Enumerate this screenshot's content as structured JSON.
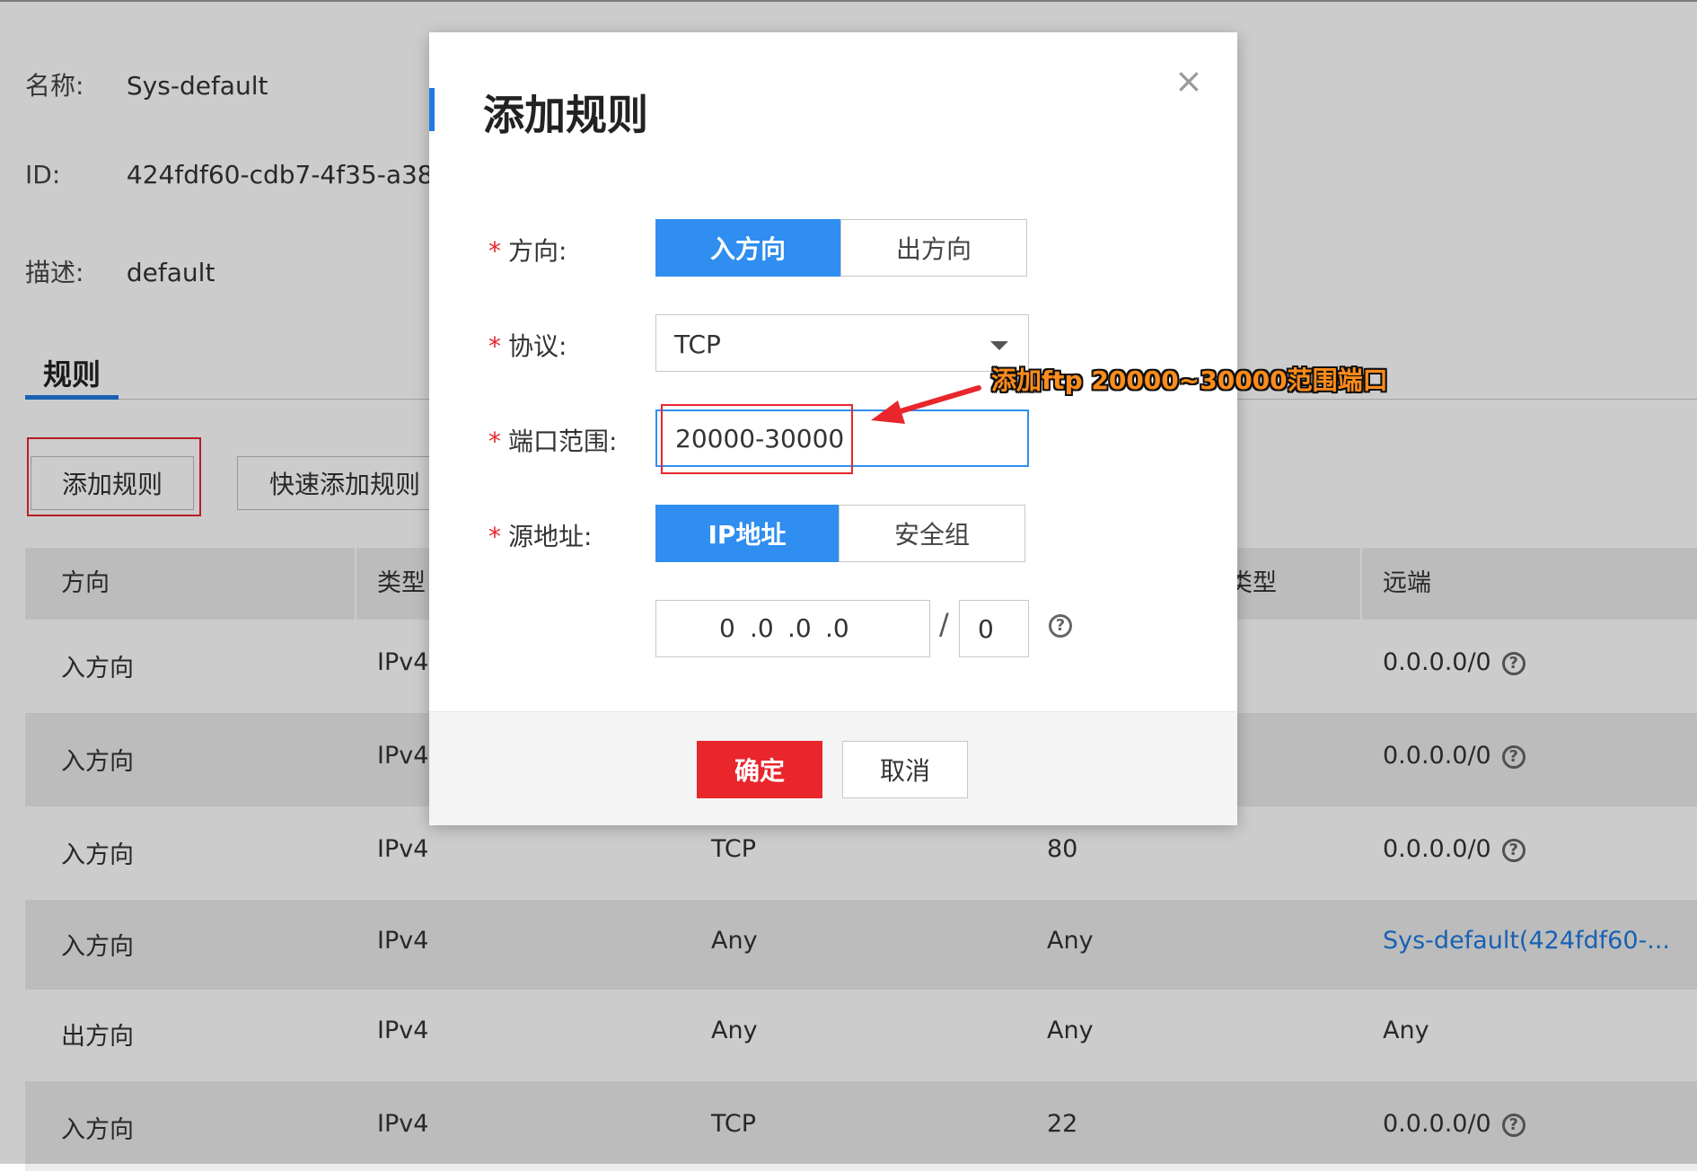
{
  "info": {
    "name_label": "名称:",
    "name_value": "Sys-default",
    "id_label": "ID:",
    "id_value": "424fdf60-cdb7-4f35-a38",
    "desc_label": "描述:",
    "desc_value": "default"
  },
  "tabs": {
    "rules": "规则"
  },
  "toolbar": {
    "add_rule": "添加规则",
    "quick_add": "快速添加规则"
  },
  "table": {
    "headers": [
      "方向",
      "类型",
      "",
      "类型",
      "远端"
    ],
    "rows": [
      {
        "direction": "入方向",
        "type": "IPv4",
        "protocol": "",
        "port": "",
        "remote": "0.0.0.0/0",
        "help": true,
        "link": false
      },
      {
        "direction": "入方向",
        "type": "IPv4",
        "protocol": "",
        "port": "",
        "remote": "0.0.0.0/0",
        "help": true,
        "link": false
      },
      {
        "direction": "入方向",
        "type": "IPv4",
        "protocol": "TCP",
        "port": "80",
        "remote": "0.0.0.0/0",
        "help": true,
        "link": false
      },
      {
        "direction": "入方向",
        "type": "IPv4",
        "protocol": "Any",
        "port": "Any",
        "remote": "Sys-default(424fdf60-...",
        "help": false,
        "link": true
      },
      {
        "direction": "出方向",
        "type": "IPv4",
        "protocol": "Any",
        "port": "Any",
        "remote": "Any",
        "help": false,
        "link": false
      },
      {
        "direction": "入方向",
        "type": "IPv4",
        "protocol": "TCP",
        "port": "22",
        "remote": "0.0.0.0/0",
        "help": true,
        "link": false
      }
    ]
  },
  "modal": {
    "title": "添加规则",
    "close": "×",
    "required_mark": "*",
    "direction_label": "方向:",
    "direction_in": "入方向",
    "direction_out": "出方向",
    "protocol_label": "协议:",
    "protocol_value": "TCP",
    "port_label": "端口范围:",
    "port_value": "20000-30000",
    "source_label": "源地址:",
    "source_ip": "IP地址",
    "source_group": "安全组",
    "ip_octets": [
      "0",
      ".0",
      ".0",
      ".0"
    ],
    "slash": "/",
    "mask": "0",
    "help_glyph": "?",
    "ok": "确定",
    "cancel": "取消"
  },
  "annotation": {
    "text": "添加ftp 20000~30000范围端口",
    "color": "#ff8c1a"
  },
  "colors": {
    "primary": "#2f8ef0",
    "danger": "#e8262c",
    "link": "#1f7ae0"
  }
}
